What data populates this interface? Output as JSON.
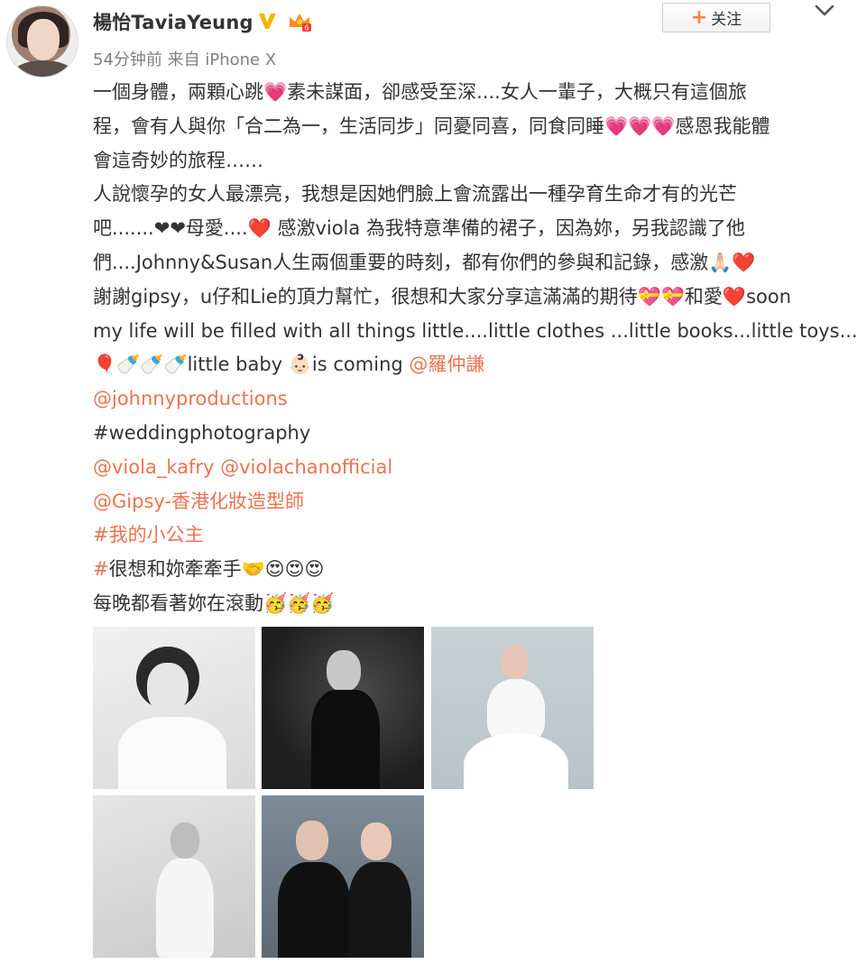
{
  "header": {
    "username": "楊怡TaviaYeung",
    "time": "54分钟前",
    "source": "来自 iPhone X",
    "follow_label": "关注"
  },
  "post": {
    "lines": [
      [
        {
          "t": "一個身體，兩顆心跳💗素未謀面，卻感受至深....女人一輩子，大概只有這個旅"
        }
      ],
      [
        {
          "t": "程，會有人與你「合二為一，生活同步」同憂同喜，同食同睡💗💗💗感恩我能體"
        }
      ],
      [
        {
          "t": "會這奇妙的旅程……"
        }
      ],
      [
        {
          "t": "人說懷孕的女人最漂亮，我想是因她們臉上會流露出一種孕育生命才有的光芒"
        }
      ],
      [
        {
          "t": "吧.......❤❤母愛....❤️ 感激viola 為我特意準備的裙子，因為妳，另我認識了他"
        }
      ],
      [
        {
          "t": "們....Johnny&Susan人生兩個重要的時刻，都有你們的參與和記錄，感激🙏🏻❤️"
        }
      ],
      [
        {
          "t": "謝謝gipsy，u仔和Lie的頂力幫忙，很想和大家分享這滿滿的期待💝💝和愛❤️soon"
        }
      ],
      [
        {
          "t": "my life will be filled with all things little....little clothes ...little books...little toys....🧸"
        }
      ],
      [
        {
          "t": "🎈🍼🍼🍼little baby 👶🏻is coming "
        },
        {
          "t": "@羅仲謙",
          "link": true
        }
      ],
      [
        {
          "t": "@johnnyproductions",
          "link": true
        }
      ],
      [
        {
          "t": "#weddingphotography"
        }
      ],
      [
        {
          "t": "@viola_kafry @violachanofficial",
          "link": true
        }
      ],
      [
        {
          "t": "@Gipsy-香港化妝造型師",
          "link": true
        }
      ],
      [
        {
          "t": "#我的小公主",
          "link": true
        }
      ],
      [
        {
          "t": "#",
          "link": true
        },
        {
          "t": "很想和妳牽牽手🤝😍😍😍"
        }
      ],
      [
        {
          "t": "每晚都看著妳在滾動🥳🥳🥳"
        }
      ]
    ]
  },
  "photos": [
    {
      "name": "photo-1-bw-portrait-white-shirt"
    },
    {
      "name": "photo-2-black-dress-dark-background"
    },
    {
      "name": "photo-3-white-tutu-dress"
    },
    {
      "name": "photo-4-bw-white-dress"
    },
    {
      "name": "photo-5-couple-black-outfits"
    }
  ],
  "icons": {
    "verified": "verified-v-icon",
    "member": "crown-member-icon",
    "more": "chevron-down-icon"
  },
  "colors": {
    "link": "#eb7350",
    "verified": "#f7b500",
    "follow_plus": "#ff8140",
    "meta": "#808080"
  }
}
